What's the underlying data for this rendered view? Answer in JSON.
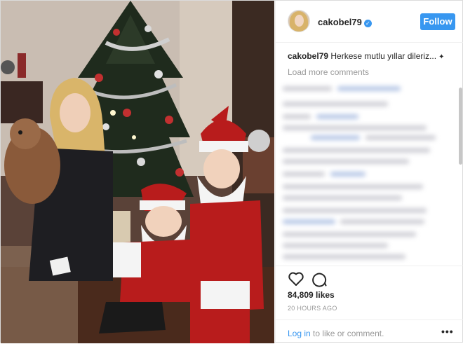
{
  "post": {
    "username": "cakobel79",
    "verified_glyph": "✓",
    "follow_label": "Follow",
    "caption_user": "cakobel79",
    "caption_text": "Herkese mutlu yıllar dileriz...",
    "load_more_label": "Load more comments",
    "likes": "84,809 likes",
    "time_ago": "20 HOURS AGO",
    "login_link": "Log in",
    "login_suffix": " to like or comment.",
    "more_label": "•••"
  },
  "icons": {
    "like": "heart-icon",
    "comment": "comment-bubble-icon",
    "verified": "verified-badge-icon",
    "more": "more-options-icon"
  },
  "colors": {
    "accent": "#3897f0",
    "muted": "#999999",
    "border": "#efefef"
  }
}
